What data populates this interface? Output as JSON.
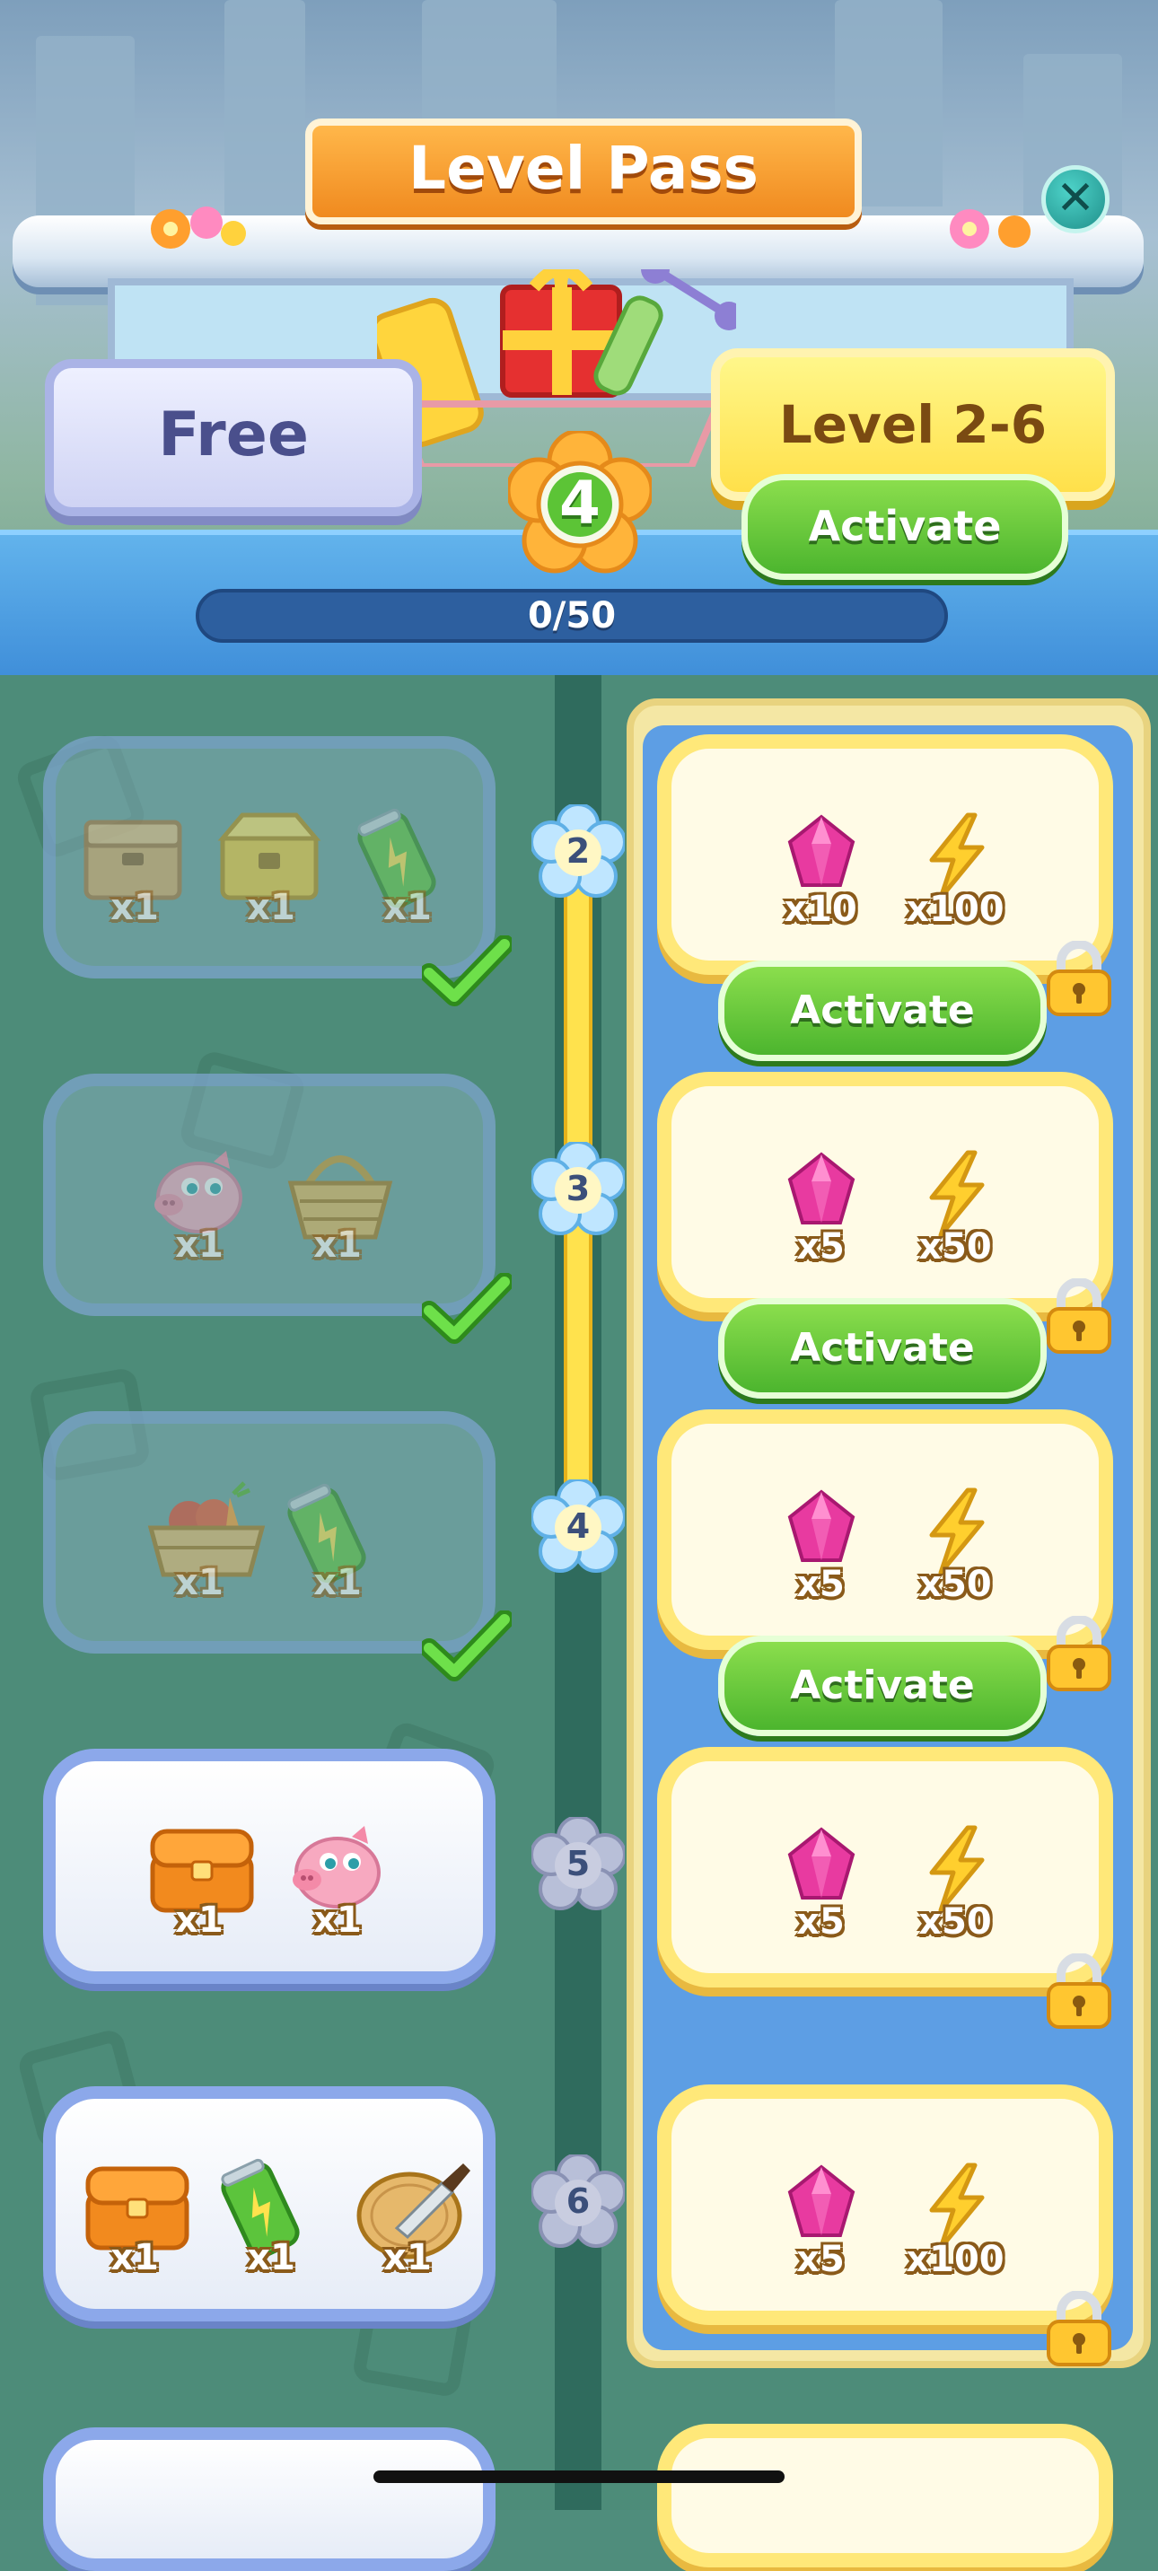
{
  "header": {
    "title": "Level Pass",
    "free_label": "Free",
    "premium_label": "Level 2-6",
    "activate_label": "Activate",
    "current_level": "4",
    "progress_text": "0/50",
    "progress_fraction": 0
  },
  "rows": [
    {
      "level": "2",
      "free_claimed": true,
      "free_items": [
        {
          "icon": "wooden-chest-icon",
          "qty": "x1"
        },
        {
          "icon": "golden-chest-icon",
          "qty": "x1"
        },
        {
          "icon": "energy-can-icon",
          "qty": "x1"
        }
      ],
      "premium_items": [
        {
          "icon": "gem-icon",
          "qty": "x10"
        },
        {
          "icon": "lightning-icon",
          "qty": "x100"
        }
      ],
      "activate_label": "Activate"
    },
    {
      "level": "3",
      "free_claimed": true,
      "free_items": [
        {
          "icon": "piggy-bank-icon",
          "qty": "x1"
        },
        {
          "icon": "basket-icon",
          "qty": "x1"
        }
      ],
      "premium_items": [
        {
          "icon": "gem-icon",
          "qty": "x5"
        },
        {
          "icon": "lightning-icon",
          "qty": "x50"
        }
      ],
      "activate_label": "Activate"
    },
    {
      "level": "4",
      "free_claimed": true,
      "free_items": [
        {
          "icon": "vegetable-crate-icon",
          "qty": "x1"
        },
        {
          "icon": "energy-can-icon",
          "qty": "x1"
        }
      ],
      "premium_items": [
        {
          "icon": "gem-icon",
          "qty": "x5"
        },
        {
          "icon": "lightning-icon",
          "qty": "x50"
        }
      ],
      "activate_label": "Activate"
    },
    {
      "level": "5",
      "free_claimed": false,
      "free_items": [
        {
          "icon": "orange-chest-icon",
          "qty": "x1"
        },
        {
          "icon": "piggy-bank-icon",
          "qty": "x1"
        }
      ],
      "premium_items": [
        {
          "icon": "gem-icon",
          "qty": "x5"
        },
        {
          "icon": "lightning-icon",
          "qty": "x50"
        }
      ]
    },
    {
      "level": "6",
      "free_claimed": false,
      "free_items": [
        {
          "icon": "orange-chest-icon",
          "qty": "x1"
        },
        {
          "icon": "energy-can-icon",
          "qty": "x1"
        },
        {
          "icon": "cutting-board-icon",
          "qty": "x1"
        }
      ],
      "premium_items": [
        {
          "icon": "gem-icon",
          "qty": "x5"
        },
        {
          "icon": "lightning-icon",
          "qty": "x100"
        }
      ]
    }
  ],
  "colors": {
    "accent_green": "#4cb52e",
    "gold": "#ffe04a",
    "sky_blue": "#5d9ee4",
    "orange": "#f08a1f"
  }
}
